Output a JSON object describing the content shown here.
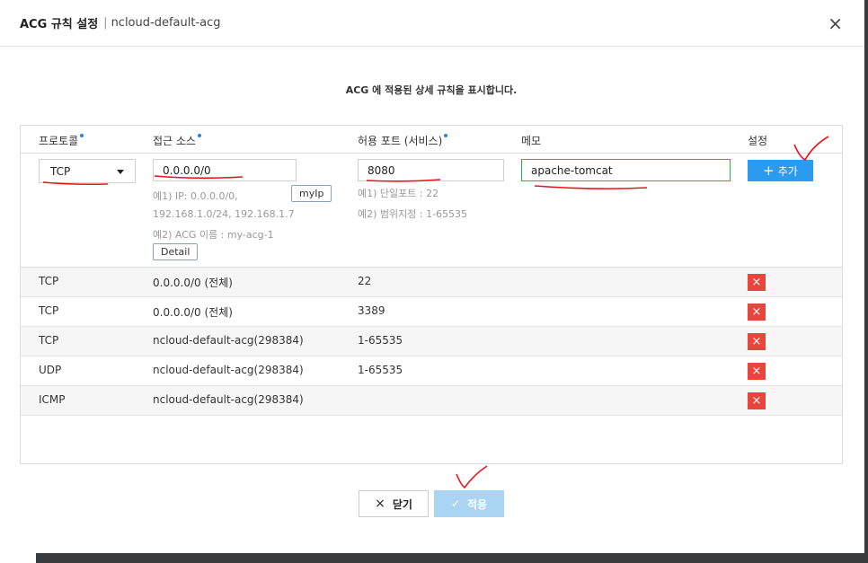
{
  "dialog": {
    "title": "ACG 규칙 설정",
    "separator": "|",
    "acg_name": "ncloud-default-acg",
    "close_icon": "×",
    "description": "ACG 에 적용된 상세 규칙을 표시합니다."
  },
  "columns": {
    "protocol": "프로토콜",
    "source": "접근 소스",
    "port": "허용 포트 (서비스)",
    "memo": "메모",
    "setting": "설정"
  },
  "form": {
    "protocol_selected": "TCP",
    "source_value": "0.0.0.0/0",
    "source_hint1": "예1) IP: 0.0.0.0/0,",
    "source_hint2": "192.168.1.0/24, 192.168.1.7",
    "source_hint3": "예2) ACG 이름 : my-acg-1",
    "myip_label": "myIp",
    "detail_label": "Detail",
    "port_value": "8080",
    "port_hint1": "예1) 단일포트 : 22",
    "port_hint2": "예2) 범위지정 : 1-65535",
    "memo_value": "apache-tomcat",
    "add_label": "추가",
    "add_icon": "+"
  },
  "rules": [
    {
      "protocol": "TCP",
      "source": "0.0.0.0/0 (전체)",
      "port": "22",
      "delete_icon": "×"
    },
    {
      "protocol": "TCP",
      "source": "0.0.0.0/0 (전체)",
      "port": "3389",
      "delete_icon": "×"
    },
    {
      "protocol": "TCP",
      "source": "ncloud-default-acg(298384)",
      "port": "1-65535",
      "delete_icon": "×"
    },
    {
      "protocol": "UDP",
      "source": "ncloud-default-acg(298384)",
      "port": "1-65535",
      "delete_icon": "×"
    },
    {
      "protocol": "ICMP",
      "source": "ncloud-default-acg(298384)",
      "port": "",
      "delete_icon": "×"
    }
  ],
  "footer": {
    "close_label": "닫기",
    "close_icon": "×",
    "apply_label": "적용",
    "apply_icon": "✓"
  },
  "colors": {
    "accent": "#2b9bf0",
    "delete": "#e8453c",
    "annotation": "#e8141c"
  }
}
